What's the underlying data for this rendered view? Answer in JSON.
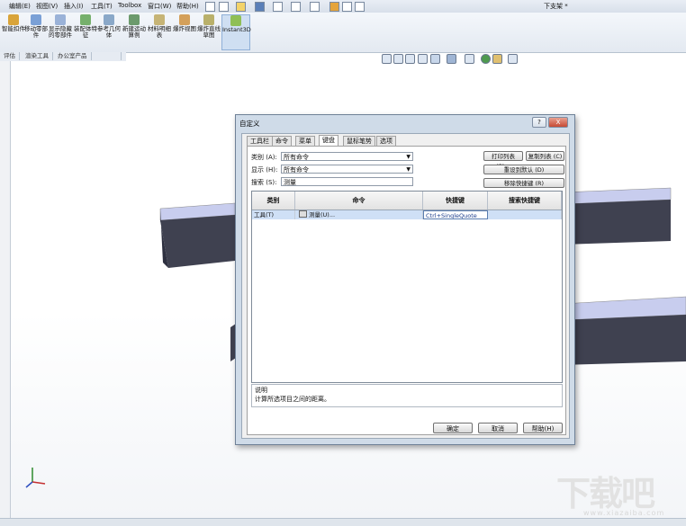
{
  "menu": {
    "items": [
      "编辑(E)",
      "视图(V)",
      "插入(I)",
      "工具(T)",
      "Toolbox",
      "窗口(W)",
      "帮助(H)"
    ],
    "document_title": "下支架 *"
  },
  "ribbon": {
    "buttons": [
      "智能扣件",
      "移动零部件",
      "显示隐藏的零部件",
      "装配体特征",
      "参考几何体",
      "新建运动算例",
      "材料明细表",
      "爆炸视图",
      "爆炸直线草图",
      "Instant3D"
    ],
    "active": "Instant3D",
    "command_tabs": [
      "评估",
      "渲染工具",
      "办公室产品"
    ]
  },
  "dialog": {
    "title": "自定义",
    "help_btn": "?",
    "close_btn": "X",
    "tabs": [
      "工具栏",
      "命令",
      "菜单",
      "键盘",
      "鼠标笔势",
      "选项"
    ],
    "selected_tab": "键盘",
    "category_label": "类别 (A):",
    "category_value": "所有命令",
    "show_label": "显示 (H):",
    "show_value": "所有命令",
    "search_label": "搜索 (S):",
    "search_value": "测量",
    "print_list": "打印列表 (P)...",
    "copy_list": "复制列表 (C)",
    "reset_default": "重设到默认 (D)",
    "remove_shortcut": "移除快捷键 (R)",
    "columns": [
      "类别",
      "命令",
      "快捷键",
      "搜索快捷键"
    ],
    "rows": [
      {
        "category": "工具(T)",
        "command": "测量(U)...",
        "shortcut": "Ctrl+SingleQuote",
        "search_shortcut": ""
      }
    ],
    "desc_label": "说明",
    "desc_text": "计算所选项目之间的距离。",
    "ok": "确定",
    "cancel": "取消",
    "help": "帮助(H)"
  },
  "watermark": {
    "text": "下载吧",
    "sub": "www.xiazaiba.com"
  },
  "colors": {
    "beam_top": "#c8cdee",
    "beam_side": "#3f4150",
    "selection": "#cfe0f6"
  }
}
